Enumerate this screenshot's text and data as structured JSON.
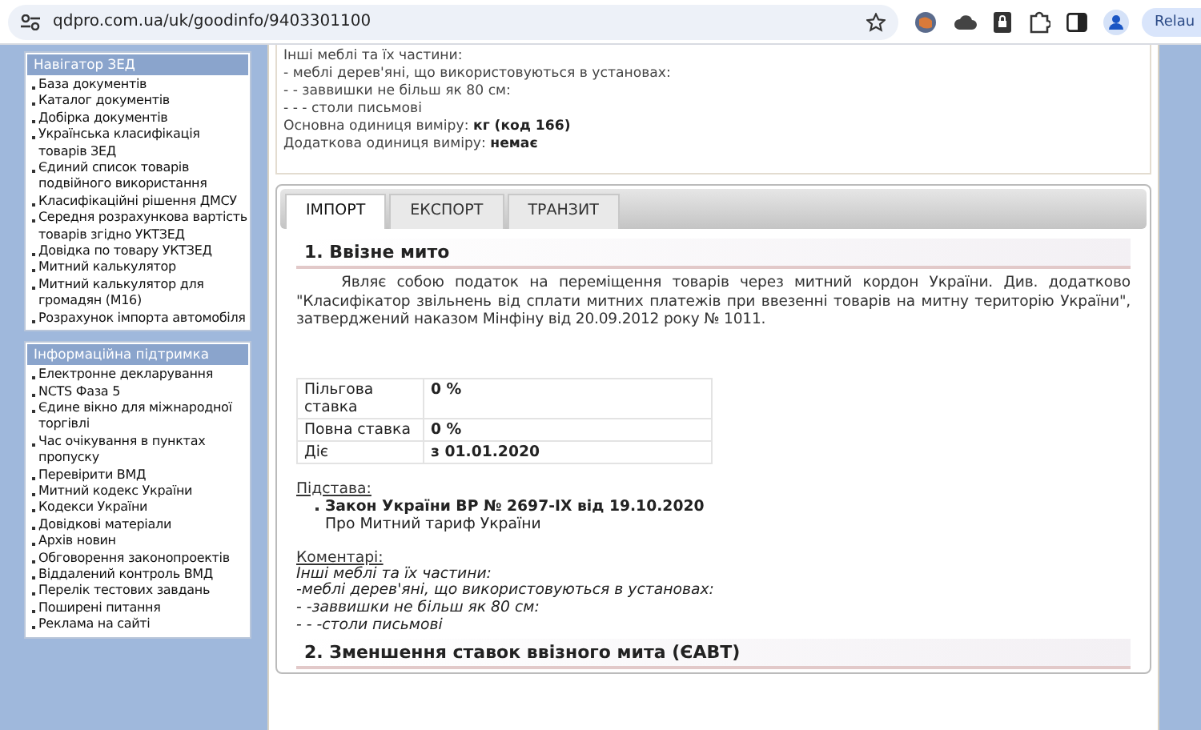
{
  "browser": {
    "url": "qdpro.com.ua/uk/goodinfo/9403301100",
    "relaunch": "Relau"
  },
  "sidebar": {
    "sections": [
      {
        "title": "Навігатор ЗЕД",
        "items": [
          "База документів",
          "Каталог документів",
          "Добірка документів",
          "Українська класифікація товарів ЗЕД",
          "Єдиний список товарів подвійного використання",
          "Класифікаційні рішення ДМСУ",
          "Середня розрахункова вартість товарів згідно УКТЗЕД",
          "Довідка по товару УКТЗЕД",
          "Митний калькулятор",
          "Митний калькулятор для громадян (М16)",
          "Розрахунок імпорта автомобіля"
        ]
      },
      {
        "title": "Інформаційна підтримка",
        "items": [
          "Електронне декларування",
          "NCTS Фаза 5",
          "Єдине вікно для міжнародної торгівлі",
          "Час очікування в пунктах пропуску",
          "Перевірити ВМД",
          "Митний кодекс України",
          "Кодекси України",
          "Довідкові матеріали",
          "Архів новин",
          "Обговорення законопроектів",
          "Віддалений контроль ВМД",
          "Перелік тестових завдань",
          "Поширені питання",
          "Реклама на сайті"
        ]
      }
    ]
  },
  "description": {
    "lines": [
      "Інші меблі та їх частини:",
      "- меблі дерев'яні, що використовуються в установах:",
      "- - заввишки не більш як 80 см:",
      "- - - столи письмові"
    ],
    "units": [
      {
        "label": "Основна одиниця виміру:",
        "value": "кг (код 166)"
      },
      {
        "label": "Додаткова одиниця виміру:",
        "value": "немає"
      }
    ]
  },
  "tabs": [
    {
      "label": "ІМПОРТ",
      "selected": true
    },
    {
      "label": "ЕКСПОРТ",
      "selected": false
    },
    {
      "label": "ТРАНЗИТ",
      "selected": false
    }
  ],
  "import_duty": {
    "heading": "1. Ввізне мито",
    "paragraph": "Являє собою податок на переміщення товарів через митний кордон України. Див. додатково \"Класифікатор звільнень від сплати митних платежів при ввезенні товарів на митну територію України\", затверджений наказом Мінфіну від 20.09.2012 року № 1011.",
    "rates": [
      {
        "label": "Пільгова ставка",
        "value": "0 %"
      },
      {
        "label": "Повна ставка",
        "value": "0 %"
      },
      {
        "label": "Діє",
        "value": "з 01.01.2020"
      }
    ],
    "basis": {
      "label": "Підстава:",
      "law": "Закон України ВР № 2697-IX від 19.10.2020",
      "law_subtitle": "Про Митний тариф України"
    },
    "comments": {
      "label": "Коментарі:",
      "lines": [
        "Інші меблі та їх частини:",
        "-меблі дерев'яні, що використовуються в установах:",
        "- -заввишки не більш як 80 см:",
        "- - -столи письмові"
      ]
    }
  },
  "reduction": {
    "heading": "2. Зменшення ставок ввізного мита (ЄАВТ)"
  }
}
